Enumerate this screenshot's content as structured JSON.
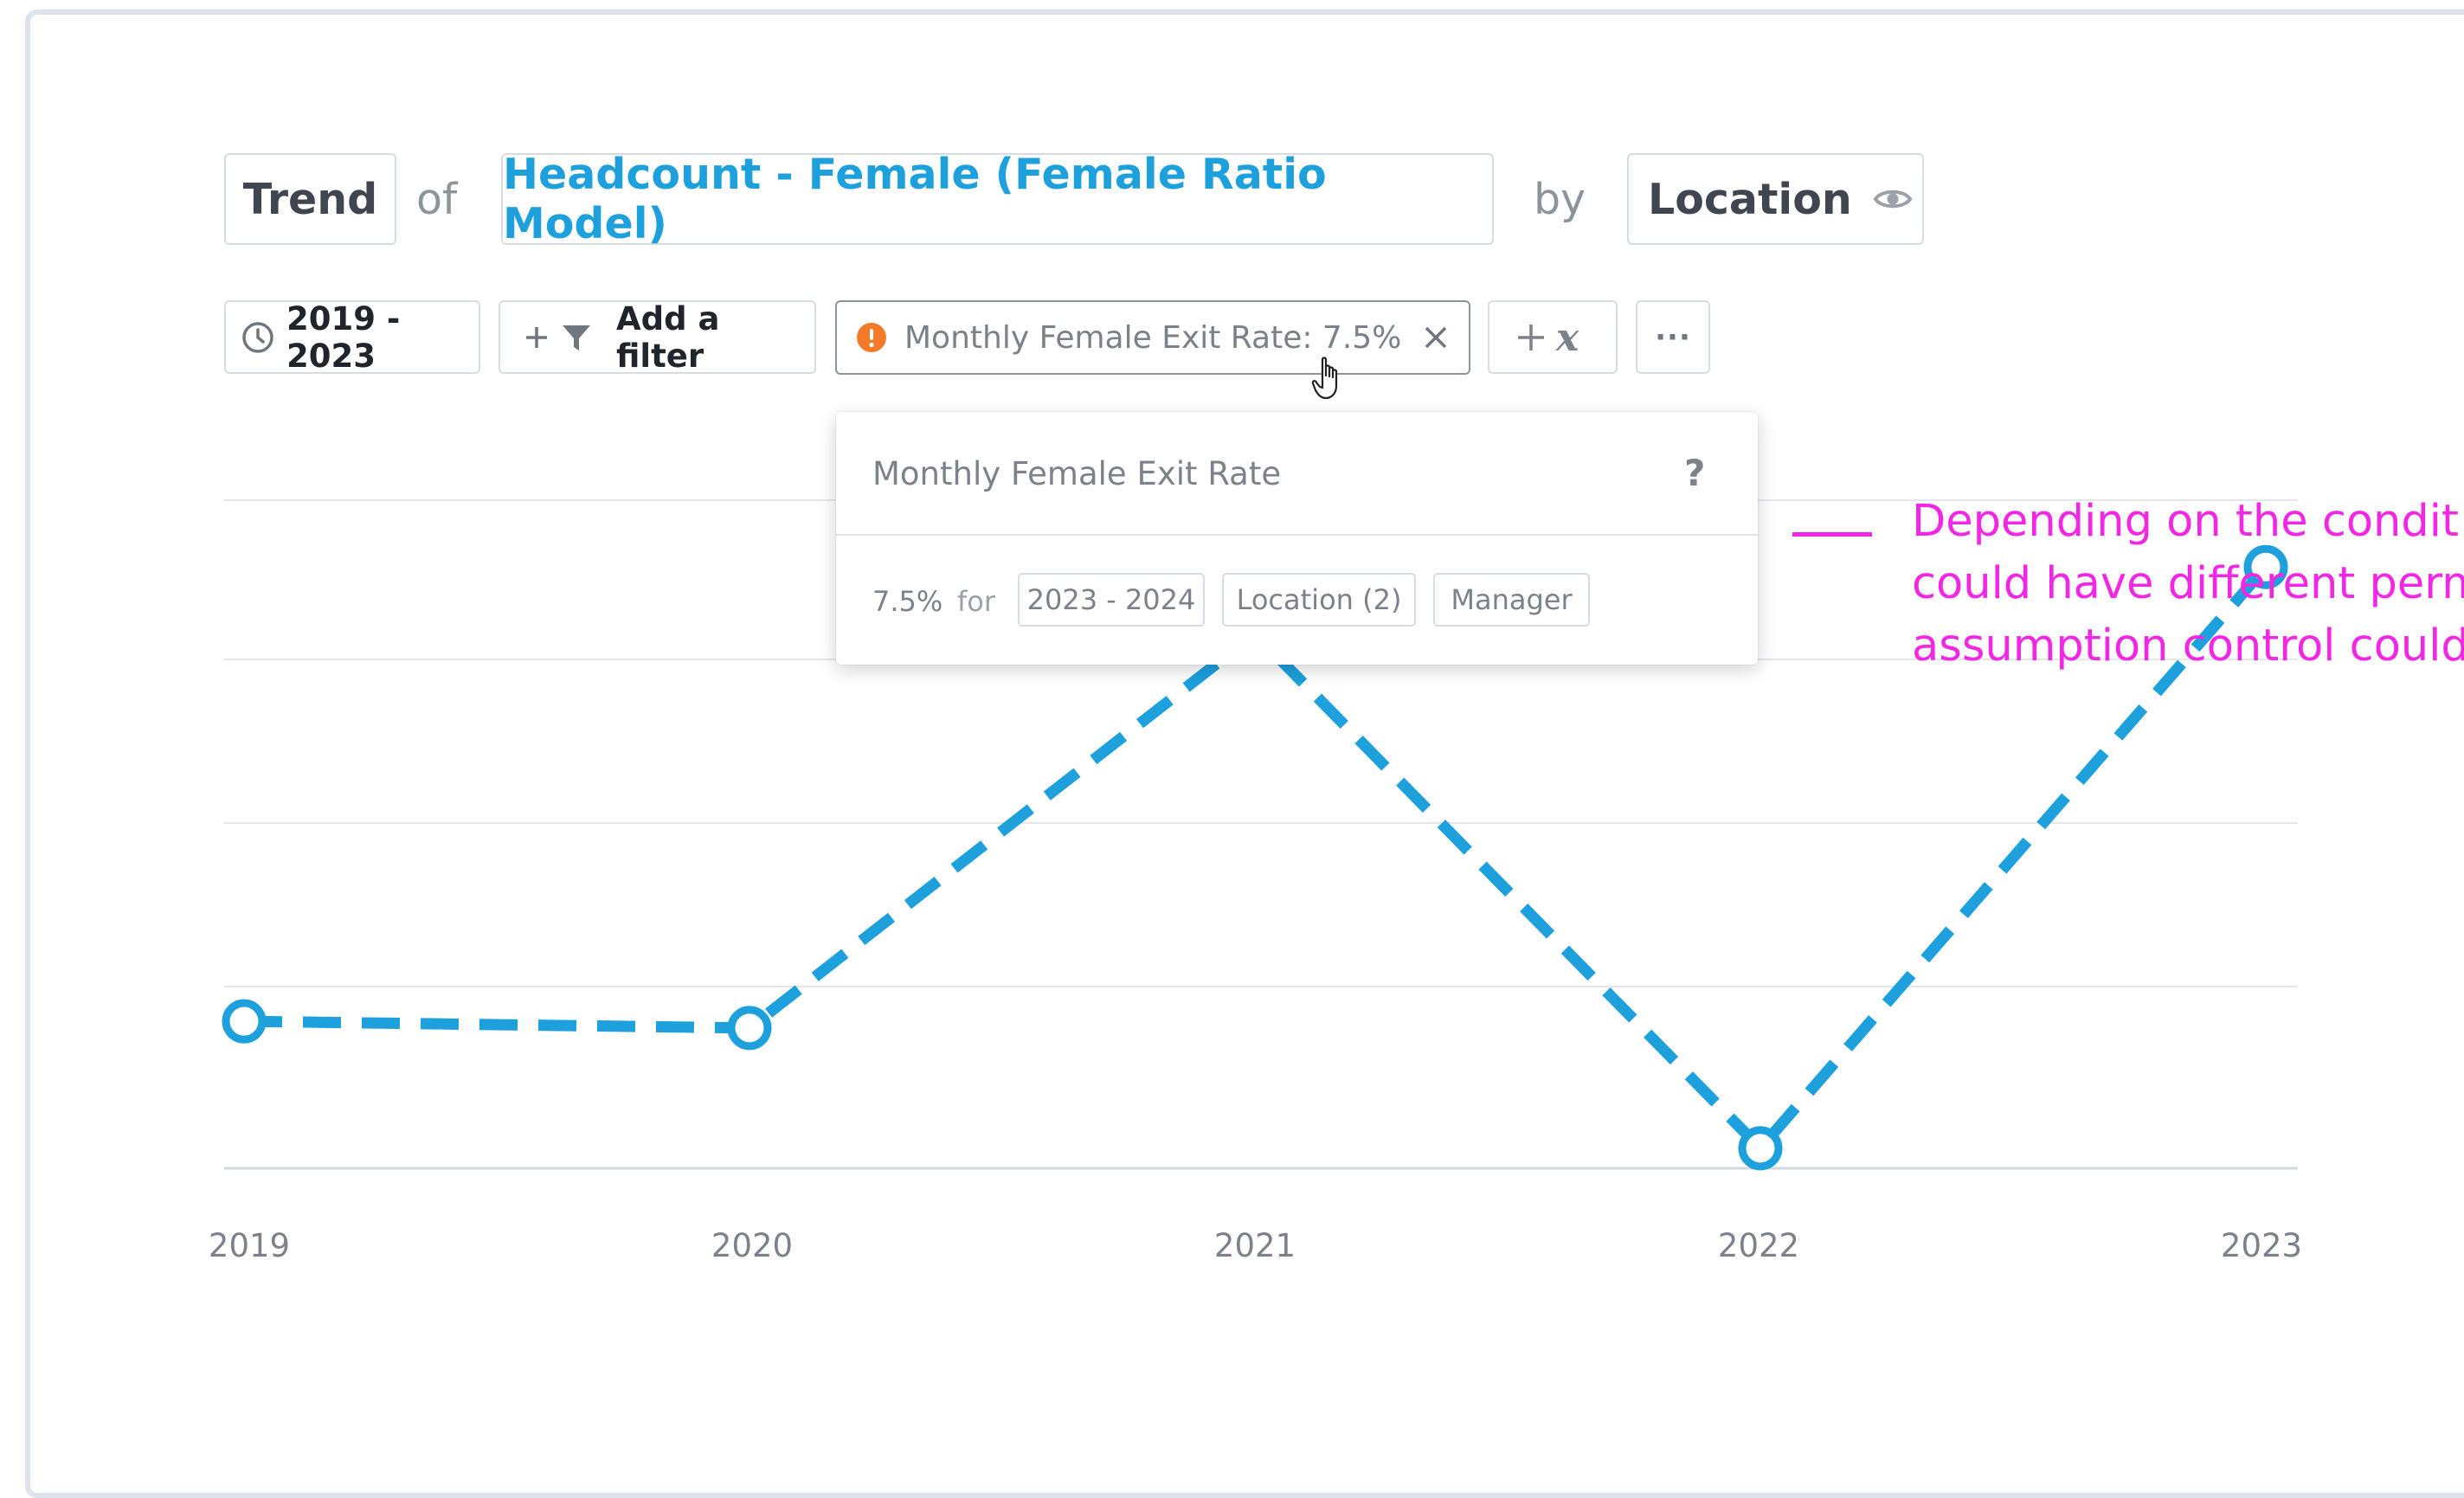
{
  "query": {
    "type_label": "Trend",
    "of_word": "of",
    "metric_label": "Headcount - Female (Female Ratio Model)",
    "by_word": "by",
    "dimension_label": "Location"
  },
  "controls": {
    "time_range": "2019 - 2023",
    "add_filter": "Add a filter",
    "assumption": "Monthly Female Exit Rate: 7.5%",
    "more": "···"
  },
  "popover": {
    "title": "Monthly Female Exit Rate",
    "help": "?",
    "value": "7.5%",
    "for_word": "for",
    "tags": [
      "2023 - 2024",
      "Location (2)",
      "Manager"
    ]
  },
  "annotation": {
    "lines": [
      "Depending on the condit",
      "could have different perm",
      "assumption control could"
    ]
  },
  "colors": {
    "series": "#1da0dc",
    "annotation": "#f227e6",
    "warning": "#f47a2a"
  },
  "icons": {
    "time": "clock-icon",
    "filter": "funnel-icon",
    "warning": "warning-circle-icon",
    "remove": "close-icon",
    "variable": "add-variable-icon",
    "visibility": "eye-icon",
    "cursor": "hand-cursor-icon"
  },
  "chart_data": {
    "type": "line",
    "categories": [
      "2019",
      "2020",
      "2021",
      "2022",
      "2023"
    ],
    "series": [
      {
        "values": [
          0.22,
          0.21,
          0.8,
          0.03,
          0.9
        ]
      }
    ],
    "ylim": [
      0,
      1
    ],
    "grid": true,
    "line_style": "dashed",
    "markers": "hollow-circle"
  }
}
